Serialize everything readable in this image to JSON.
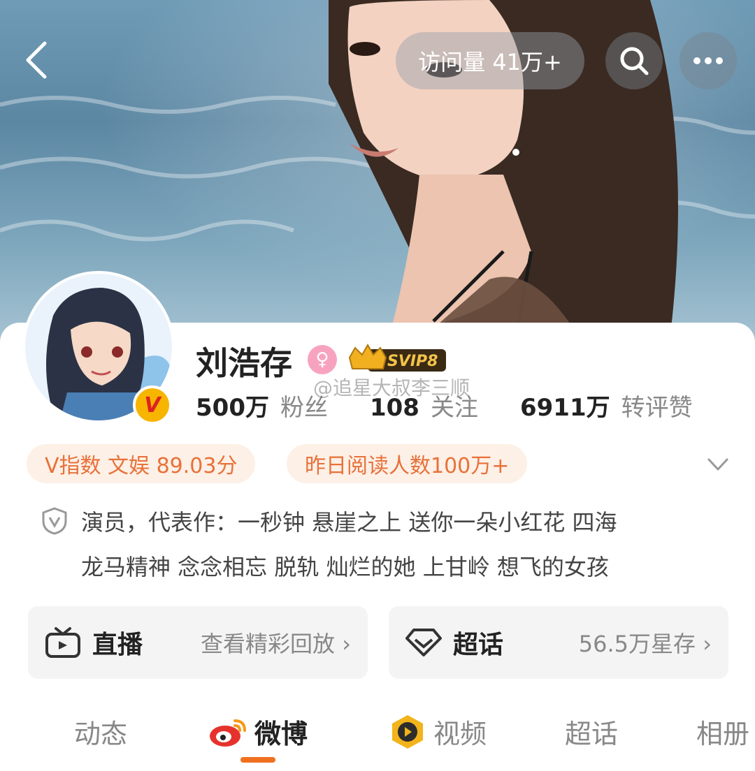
{
  "header": {
    "visits": "访问量 41万+",
    "back_icon": "back-arrow-icon",
    "search_icon": "search-icon",
    "more_icon": "more-icon"
  },
  "profile": {
    "name": "刘浩存",
    "gender_icon": "female-icon",
    "vip_badge": "SVIP8",
    "verified_badge": "V",
    "stats": [
      {
        "value": "500万",
        "label": "粉丝"
      },
      {
        "value": "108",
        "label": "关注"
      },
      {
        "value": "6911万",
        "label": "转评赞"
      }
    ],
    "watermark": "@追星大叔李三顺"
  },
  "tags": {
    "v_index": "V指数 文娱 89.03分",
    "reads": "昨日阅读人数100万+"
  },
  "bio": {
    "line1": "演员，代表作：一秒钟 悬崖之上 送你一朵小红花 四海",
    "line2": "龙马精神 念念相忘 脱轨 灿烂的她 上甘岭 想飞的女孩"
  },
  "cards": {
    "live": {
      "title": "直播",
      "sub": "查看精彩回放 ›"
    },
    "topic": {
      "title": "超话",
      "sub": "56.5万星存 ›"
    }
  },
  "tabs": [
    "动态",
    "微博",
    "视频",
    "超话",
    "相册"
  ],
  "colors": {
    "accent": "#f07020",
    "tag_bg": "#fdf0e6",
    "tag_text": "#e8713a"
  }
}
